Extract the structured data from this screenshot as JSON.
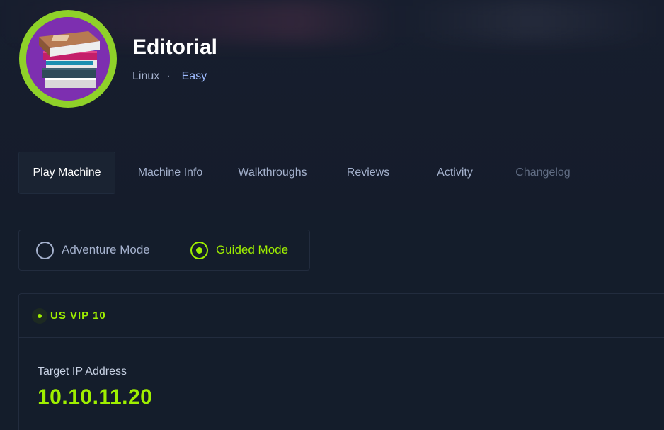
{
  "machine": {
    "name": "Editorial",
    "os": "Linux",
    "separator": "·",
    "difficulty": "Easy",
    "avatar_icon": "book-stack-icon"
  },
  "tabs": [
    {
      "label": "Play Machine"
    },
    {
      "label": "Machine Info"
    },
    {
      "label": "Walkthroughs"
    },
    {
      "label": "Reviews"
    },
    {
      "label": "Activity"
    },
    {
      "label": "Changelog"
    }
  ],
  "modes": {
    "adventure": "Adventure Mode",
    "guided": "Guided Mode",
    "selected": "Guided Mode"
  },
  "connection": {
    "server": "US VIP 10",
    "ip_label": "Target IP Address",
    "ip_value": "10.10.11.20"
  },
  "colors": {
    "background": "#141d2b",
    "accent": "#9fef00",
    "text_muted": "#a4b1cd",
    "difficulty": "#9fbcff",
    "avatar_ring": "#8fd129"
  }
}
